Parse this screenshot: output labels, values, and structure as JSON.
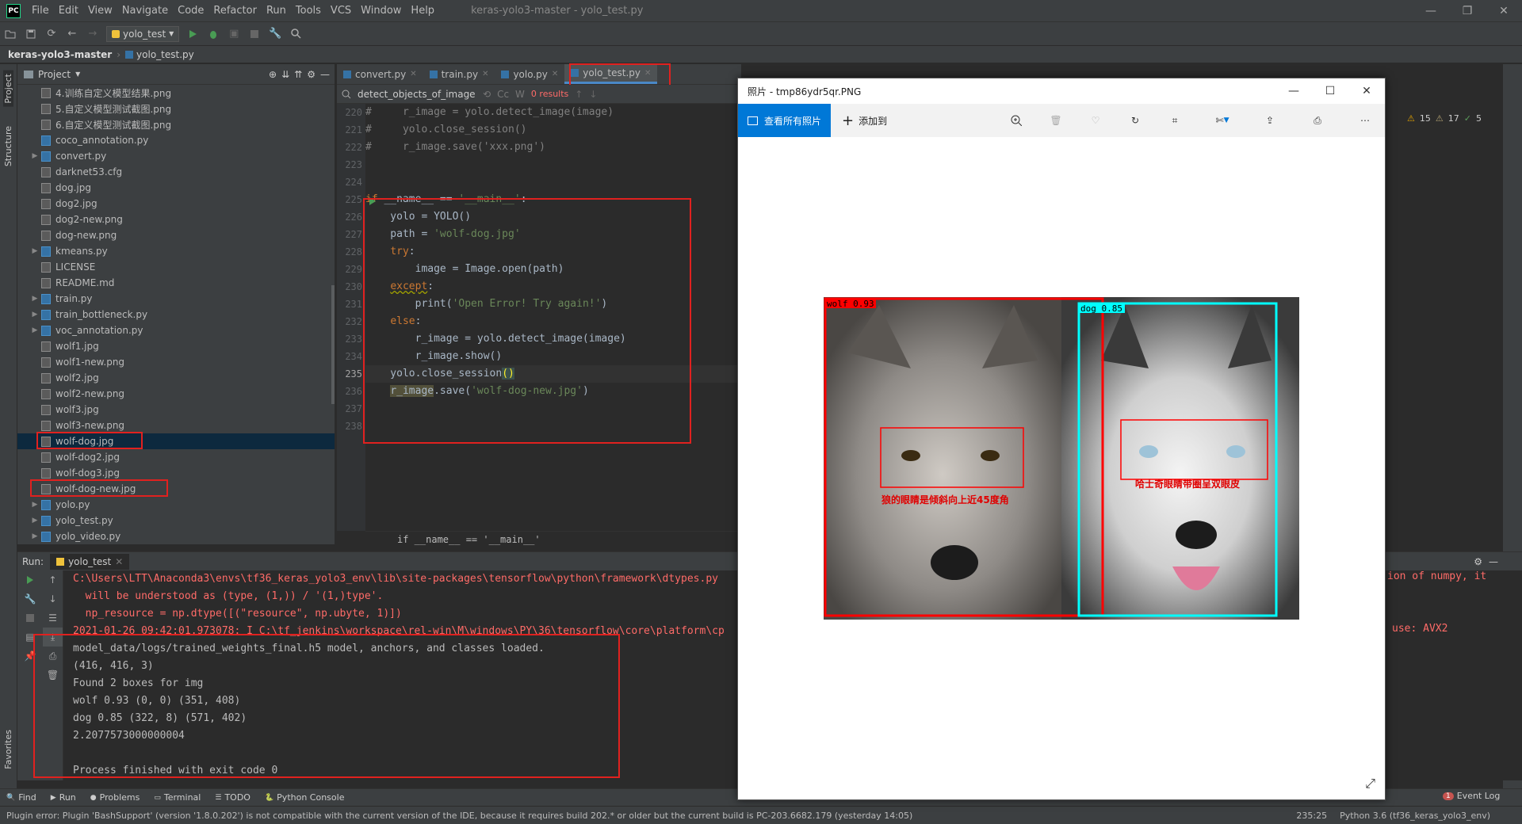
{
  "titlebar": {
    "logo": "PC",
    "menus": [
      "File",
      "Edit",
      "View",
      "Navigate",
      "Code",
      "Refactor",
      "Run",
      "Tools",
      "VCS",
      "Window",
      "Help"
    ],
    "window_title": "keras-yolo3-master - yolo_test.py",
    "controls": [
      "—",
      "❐",
      "✕"
    ]
  },
  "toolbar": {
    "run_config": "yolo_test"
  },
  "navbar": {
    "project": "keras-yolo3-master",
    "file": "yolo_test.py"
  },
  "stripe": {
    "project": "Project",
    "structure": "Structure",
    "favorites": "Favorites"
  },
  "project": {
    "header": "Project",
    "files": [
      {
        "name": "4.训练自定义模型结果.png",
        "type": "img",
        "arrow": ""
      },
      {
        "name": "5.自定义模型测试截图.png",
        "type": "img",
        "arrow": ""
      },
      {
        "name": "6.自定义模型测试截图.png",
        "type": "img",
        "arrow": ""
      },
      {
        "name": "coco_annotation.py",
        "type": "py",
        "arrow": ""
      },
      {
        "name": "convert.py",
        "type": "py",
        "arrow": "▶"
      },
      {
        "name": "darknet53.cfg",
        "type": "img",
        "arrow": ""
      },
      {
        "name": "dog.jpg",
        "type": "img",
        "arrow": ""
      },
      {
        "name": "dog2.jpg",
        "type": "img",
        "arrow": ""
      },
      {
        "name": "dog2-new.png",
        "type": "img",
        "arrow": ""
      },
      {
        "name": "dog-new.png",
        "type": "img",
        "arrow": ""
      },
      {
        "name": "kmeans.py",
        "type": "py",
        "arrow": "▶"
      },
      {
        "name": "LICENSE",
        "type": "img",
        "arrow": ""
      },
      {
        "name": "README.md",
        "type": "img",
        "arrow": ""
      },
      {
        "name": "train.py",
        "type": "py",
        "arrow": "▶"
      },
      {
        "name": "train_bottleneck.py",
        "type": "py",
        "arrow": "▶"
      },
      {
        "name": "voc_annotation.py",
        "type": "py",
        "arrow": "▶"
      },
      {
        "name": "wolf1.jpg",
        "type": "img",
        "arrow": ""
      },
      {
        "name": "wolf1-new.png",
        "type": "img",
        "arrow": ""
      },
      {
        "name": "wolf2.jpg",
        "type": "img",
        "arrow": ""
      },
      {
        "name": "wolf2-new.png",
        "type": "img",
        "arrow": ""
      },
      {
        "name": "wolf3.jpg",
        "type": "img",
        "arrow": ""
      },
      {
        "name": "wolf3-new.png",
        "type": "img",
        "arrow": ""
      },
      {
        "name": "wolf-dog.jpg",
        "type": "img",
        "arrow": "",
        "selected": true
      },
      {
        "name": "wolf-dog2.jpg",
        "type": "img",
        "arrow": ""
      },
      {
        "name": "wolf-dog3.jpg",
        "type": "img",
        "arrow": ""
      },
      {
        "name": "wolf-dog-new.jpg",
        "type": "img",
        "arrow": ""
      },
      {
        "name": "yolo.py",
        "type": "py",
        "arrow": "▶"
      },
      {
        "name": "yolo_test.py",
        "type": "py",
        "arrow": "▶"
      },
      {
        "name": "yolo_video.py",
        "type": "py",
        "arrow": "▶"
      }
    ]
  },
  "editor": {
    "tabs": [
      {
        "label": "convert.py"
      },
      {
        "label": "train.py"
      },
      {
        "label": "yolo.py"
      },
      {
        "label": "yolo_test.py",
        "active": true
      }
    ],
    "find": {
      "query": "detect_objects_of_image",
      "results": "0 results",
      "cc": "Cc",
      "w": "W"
    },
    "line_numbers": [
      "220",
      "221",
      "222",
      "223",
      "224",
      "225",
      "226",
      "227",
      "228",
      "229",
      "230",
      "231",
      "232",
      "233",
      "234",
      "235",
      "236",
      "237",
      "238"
    ],
    "breadcrumb": "if __name__ == '__main__'",
    "inspections": {
      "warnings": "15",
      "weak": "17",
      "ok": "5"
    }
  },
  "run": {
    "label": "Run:",
    "tab": "yolo_test",
    "lines": [
      {
        "t": "C:\\Users\\LTT\\Anaconda3\\envs\\tf36_keras_yolo3_env\\lib\\site-packages\\tensorflow\\python\\framework\\dtypes.py",
        "err": true
      },
      {
        "t": "  will be understood as (type, (1,)) / '(1,)type'.",
        "err": true
      },
      {
        "t": "  np_resource = np.dtype([(\"resource\", np.ubyte, 1)])",
        "err": true
      },
      {
        "t": "2021-01-26 09:42:01.973078: I C:\\tf_jenkins\\workspace\\rel-win\\M\\windows\\PY\\36\\tensorflow\\core\\platform\\cp",
        "err": true
      },
      {
        "t": "model_data/logs/trained_weights_final.h5 model, anchors, and classes loaded.",
        "err": false
      },
      {
        "t": "(416, 416, 3)",
        "err": false
      },
      {
        "t": "Found 2 boxes for img",
        "err": false
      },
      {
        "t": "wolf 0.93 (0, 0) (351, 408)",
        "err": false
      },
      {
        "t": "dog 0.85 (322, 8) (571, 402)",
        "err": false
      },
      {
        "t": "2.2077573000000004",
        "err": false
      },
      {
        "t": "",
        "err": false
      },
      {
        "t": "Process finished with exit code 0",
        "err": false
      }
    ],
    "tail_numpy": "ion of numpy, it",
    "tail_avx": "use: AVX2"
  },
  "bottombar": [
    "Find",
    "Run",
    "Problems",
    "Terminal",
    "TODO",
    "Python Console"
  ],
  "eventlog": "Event Log",
  "eventlog_count": "1",
  "status": {
    "message": "Plugin error: Plugin 'BashSupport' (version '1.8.0.202') is not compatible with the current version of the IDE, because it requires build 202.* or older but the current build is PC-203.6682.179 (yesterday 14:05)",
    "position": "235:25",
    "interpreter": "Python 3.6 (tf36_keras_yolo3_env)"
  },
  "photos": {
    "title": "照片 - tmp86ydr5qr.PNG",
    "view_all": "查看所有照片",
    "add_to": "添加到",
    "labels": {
      "wolf": "wolf 0.93",
      "dog": "dog 0.85"
    },
    "annotations": {
      "wolf_eyes": "狼的眼睛是倾斜向上近45度角",
      "dog_eyes": "哈士奇眼睛带圈呈双眼皮"
    }
  },
  "colors": {
    "ide_bg": "#2b2b2b",
    "panel": "#3c3f41",
    "highlight": "#e0211f",
    "accent": "#4a88c7",
    "photos_blue": "#0078d7",
    "wolf_box": "#ff0000",
    "dog_box": "#00ffff"
  }
}
